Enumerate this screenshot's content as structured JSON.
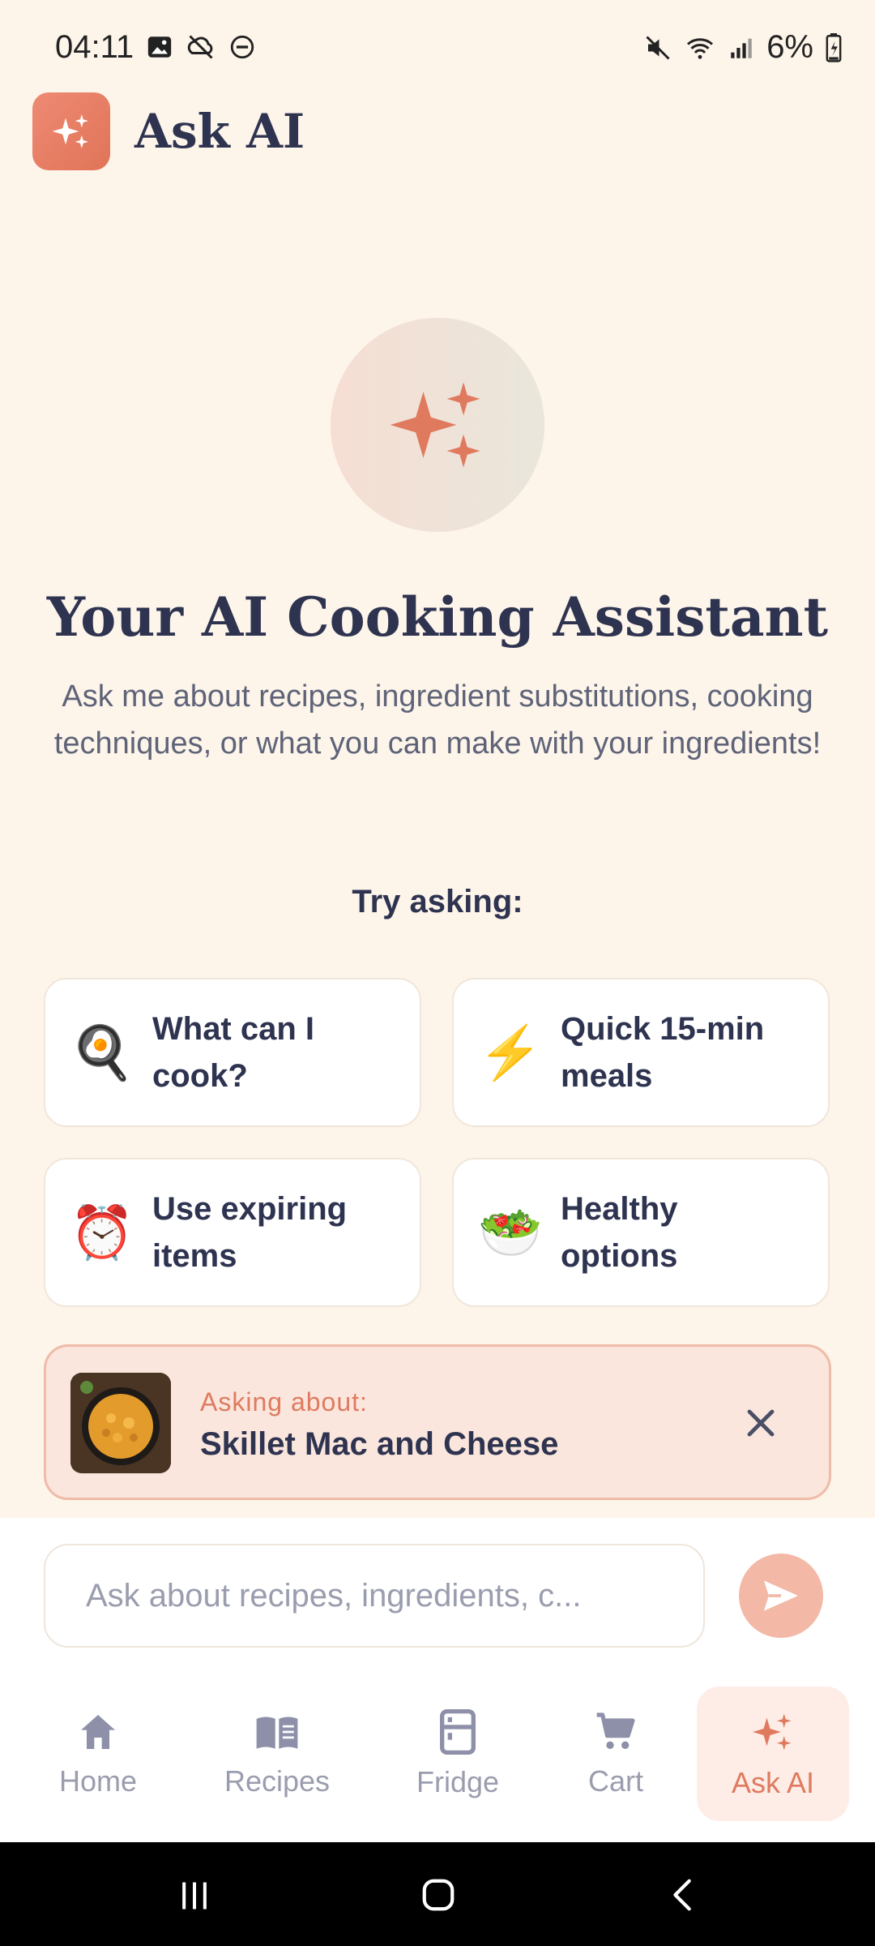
{
  "status_bar": {
    "time": "04:11",
    "battery": "6%"
  },
  "header": {
    "title": "Ask AI",
    "logo_icon": "sparkles-icon"
  },
  "hero": {
    "icon": "sparkles-icon",
    "title": "Your AI Cooking Assistant",
    "subtitle": "Ask me about recipes, ingredient substitutions, cooking techniques, or what you can make with your ingredients!"
  },
  "suggestions": {
    "heading": "Try asking:",
    "items": [
      {
        "emoji": "🍳",
        "label": "What can I cook?"
      },
      {
        "emoji": "⚡",
        "label": "Quick 15-min meals"
      },
      {
        "emoji": "⏰",
        "label": "Use expiring items"
      },
      {
        "emoji": "🥗",
        "label": "Healthy options"
      }
    ]
  },
  "context": {
    "caption": "Asking about:",
    "recipe": "Skillet Mac and Cheese"
  },
  "input": {
    "placeholder": "Ask about recipes, ingredients, c..."
  },
  "nav": {
    "items": [
      {
        "label": "Home",
        "icon": "home-icon"
      },
      {
        "label": "Recipes",
        "icon": "book-icon"
      },
      {
        "label": "Fridge",
        "icon": "fridge-icon"
      },
      {
        "label": "Cart",
        "icon": "cart-icon"
      },
      {
        "label": "Ask AI",
        "icon": "sparkles-icon",
        "active": true
      }
    ]
  },
  "colors": {
    "background": "#FDF4EA",
    "accent": "#E07A5F",
    "text": "#2E3350"
  }
}
